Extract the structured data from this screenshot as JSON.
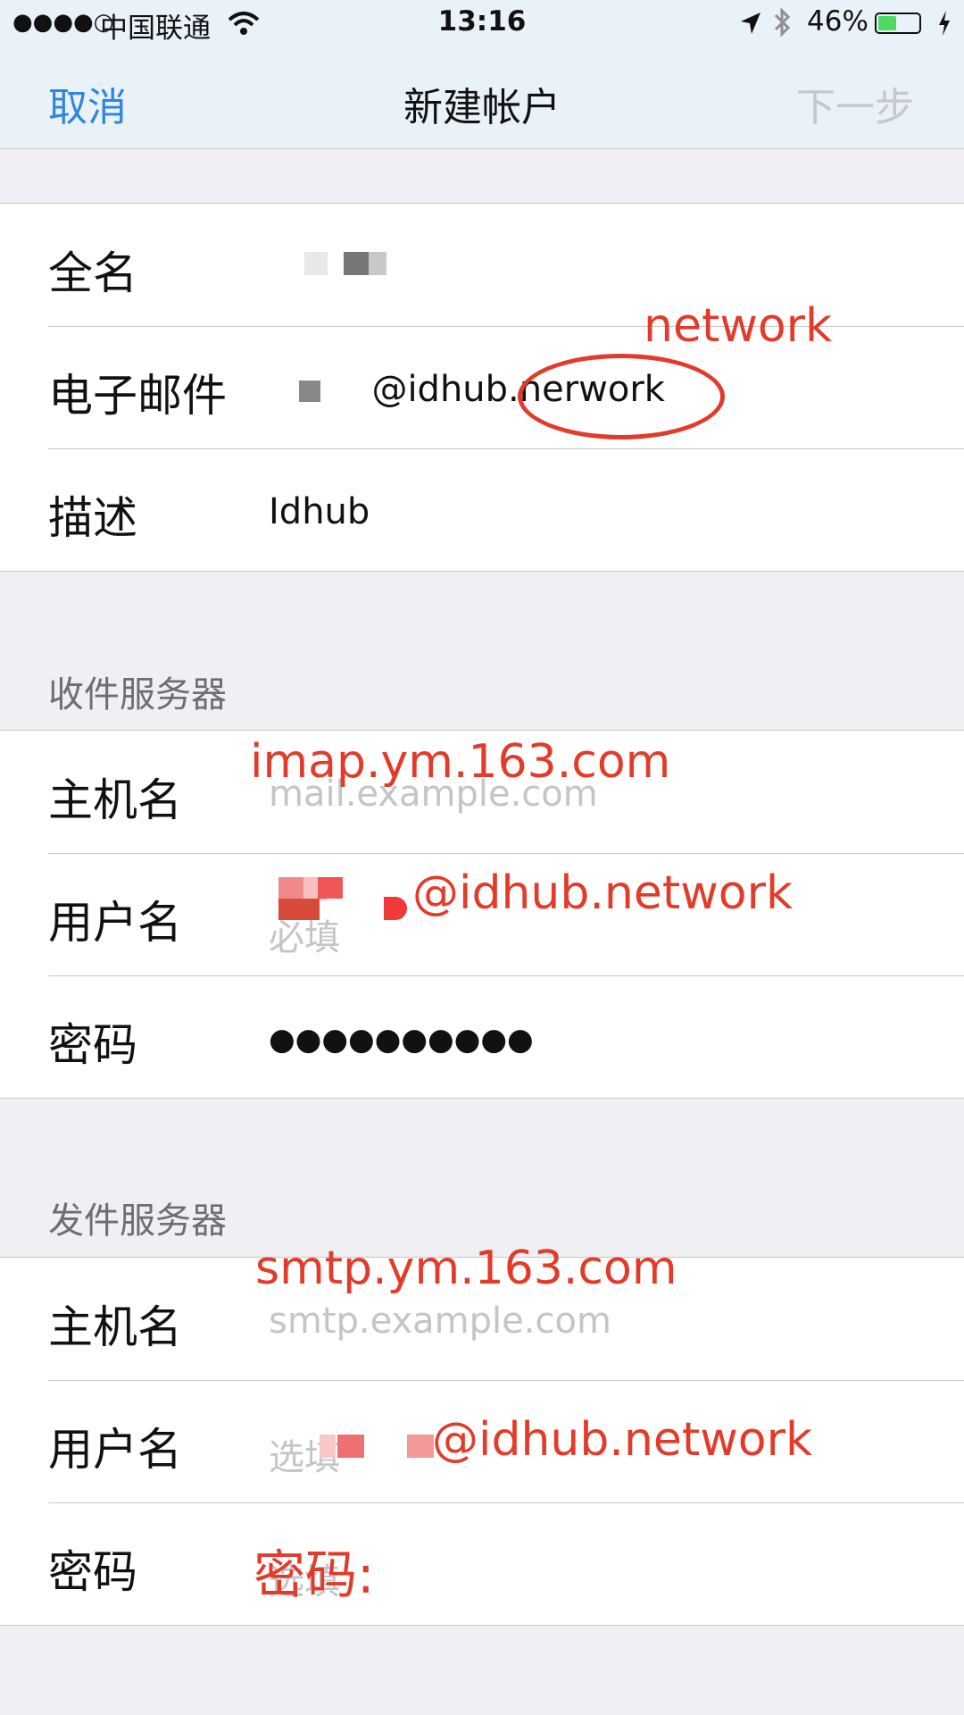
{
  "status_bar": {
    "signal": "●●●●○",
    "carrier": "中国联通",
    "time": "13:16",
    "battery_percent": "46%",
    "battery_level": 0.46,
    "battery_color": "#4cd964"
  },
  "nav": {
    "cancel": "取消",
    "title": "新建帐户",
    "next": "下一步"
  },
  "account": {
    "fullname_label": "全名",
    "email_label": "电子邮件",
    "email_value": "@idhub",
    "email_value_tail": ".nerwork",
    "description_label": "描述",
    "description_value": "Idhub"
  },
  "incoming": {
    "header": "收件服务器",
    "host_label": "主机名",
    "host_placeholder": "mail.example.com",
    "username_label": "用户名",
    "username_placeholder": "必填",
    "password_label": "密码",
    "password_value": "●●●●●●●●●●"
  },
  "outgoing": {
    "header": "发件服务器",
    "host_label": "主机名",
    "host_placeholder": "smtp.example.com",
    "username_label": "用户名",
    "username_placeholder": "选填",
    "password_label": "密码",
    "password_placeholder": "选填"
  },
  "annotations": {
    "email_fix": "network",
    "incoming_host": "imap.ym.163.com",
    "incoming_user": "@idhub.network",
    "outgoing_host": "smtp.ym.163.com",
    "outgoing_user": "@idhub.network",
    "outgoing_password": "密码:"
  },
  "colors": {
    "accent": "#2f86de",
    "annotation_red": "#e23b2a",
    "disabled": "#c7c7cc"
  }
}
